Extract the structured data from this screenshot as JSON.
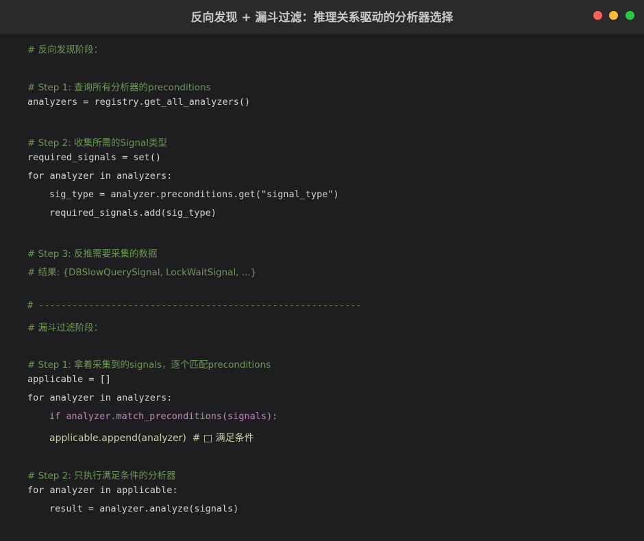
{
  "window": {
    "title": "反向发现 + 漏斗过滤：推理关系驱动的分析器选择"
  },
  "code": {
    "l1": "# 反向发现阶段：",
    "l2": "# Step 1: 查询所有分析器的preconditions",
    "l3": "analyzers = registry.get_all_analyzers()",
    "l4": "# Step 2: 收集所需的Signal类型",
    "l5": "required_signals = set()",
    "l6": "for analyzer in analyzers:",
    "l7": "sig_type = analyzer.preconditions.get(\"signal_type\")",
    "l8": "required_signals.add(sig_type)",
    "l9": "# Step 3: 反推需要采集的数据",
    "l10": "# 结果: {DBSlowQuerySignal, LockWaitSignal, ...}",
    "l11": "# ----------------------------------------------------------",
    "l12": "# 漏斗过滤阶段：",
    "l13": "# Step 1: 拿着采集到的signals，逐个匹配preconditions",
    "l14": "applicable = []",
    "l15": "for analyzer in analyzers:",
    "l16": "if analyzer.match_preconditions(signals):",
    "l17": "applicable.append(analyzer)  # □ 满足条件",
    "l18": "# Step 2: 只执行满足条件的分析器",
    "l19": "for analyzer in applicable:",
    "l20": "result = analyzer.analyze(signals)"
  }
}
